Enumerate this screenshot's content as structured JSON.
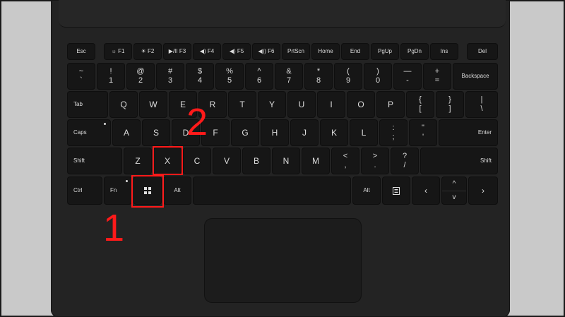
{
  "rows": {
    "function": [
      {
        "name": "key-esc",
        "label": "Esc"
      },
      {
        "name": "key-f1",
        "label": "☼ F1"
      },
      {
        "name": "key-f2",
        "label": "☀ F2"
      },
      {
        "name": "key-f3",
        "label": "▶/II F3"
      },
      {
        "name": "key-f4",
        "label": "◀) F4"
      },
      {
        "name": "key-f5",
        "label": "◀) F5"
      },
      {
        "name": "key-f6",
        "label": "◀)) F6"
      },
      {
        "name": "key-prtscn",
        "label": "PrtScn"
      },
      {
        "name": "key-home",
        "label": "Home"
      },
      {
        "name": "key-end",
        "label": "End"
      },
      {
        "name": "key-pgup",
        "label": "PgUp"
      },
      {
        "name": "key-pgdn",
        "label": "PgDn"
      },
      {
        "name": "key-ins",
        "label": "Ins"
      },
      {
        "name": "key-del",
        "label": "Del"
      }
    ],
    "number": [
      {
        "name": "key-tilde",
        "top": "~",
        "bot": "`"
      },
      {
        "name": "key-1",
        "top": "!",
        "bot": "1"
      },
      {
        "name": "key-2",
        "top": "@",
        "bot": "2"
      },
      {
        "name": "key-3",
        "top": "#",
        "bot": "3"
      },
      {
        "name": "key-4",
        "top": "$",
        "bot": "4"
      },
      {
        "name": "key-5",
        "top": "%",
        "bot": "5"
      },
      {
        "name": "key-6",
        "top": "^",
        "bot": "6"
      },
      {
        "name": "key-7",
        "top": "&",
        "bot": "7"
      },
      {
        "name": "key-8",
        "top": "*",
        "bot": "8"
      },
      {
        "name": "key-9",
        "top": "(",
        "bot": "9"
      },
      {
        "name": "key-0",
        "top": ")",
        "bot": "0"
      },
      {
        "name": "key-minus",
        "top": "—",
        "bot": "-"
      },
      {
        "name": "key-equals",
        "top": "+",
        "bot": "="
      },
      {
        "name": "key-backspace",
        "label": "Backspace"
      }
    ],
    "qwerty": [
      {
        "name": "key-tab",
        "label": "Tab"
      },
      {
        "name": "key-q",
        "label": "Q"
      },
      {
        "name": "key-w",
        "label": "W"
      },
      {
        "name": "key-e",
        "label": "E"
      },
      {
        "name": "key-r",
        "label": "R"
      },
      {
        "name": "key-t",
        "label": "T"
      },
      {
        "name": "key-y",
        "label": "Y"
      },
      {
        "name": "key-u",
        "label": "U"
      },
      {
        "name": "key-i",
        "label": "I"
      },
      {
        "name": "key-o",
        "label": "O"
      },
      {
        "name": "key-p",
        "label": "P"
      },
      {
        "name": "key-lbracket",
        "top": "{",
        "bot": "["
      },
      {
        "name": "key-rbracket",
        "top": "}",
        "bot": "]"
      },
      {
        "name": "key-backslash",
        "top": "|",
        "bot": "\\"
      }
    ],
    "home": [
      {
        "name": "key-caps",
        "label": "Caps"
      },
      {
        "name": "key-a",
        "label": "A"
      },
      {
        "name": "key-s",
        "label": "S"
      },
      {
        "name": "key-d",
        "label": "D"
      },
      {
        "name": "key-f",
        "label": "F"
      },
      {
        "name": "key-g",
        "label": "G"
      },
      {
        "name": "key-h",
        "label": "H"
      },
      {
        "name": "key-j",
        "label": "J"
      },
      {
        "name": "key-k",
        "label": "K"
      },
      {
        "name": "key-l",
        "label": "L"
      },
      {
        "name": "key-semicolon",
        "top": ":",
        "bot": ";"
      },
      {
        "name": "key-quote",
        "top": "\"",
        "bot": "'"
      },
      {
        "name": "key-enter",
        "label": "Enter"
      }
    ],
    "shift": [
      {
        "name": "key-shift-left",
        "label": "Shift"
      },
      {
        "name": "key-z",
        "label": "Z"
      },
      {
        "name": "key-x",
        "label": "X"
      },
      {
        "name": "key-c",
        "label": "C"
      },
      {
        "name": "key-v",
        "label": "V"
      },
      {
        "name": "key-b",
        "label": "B"
      },
      {
        "name": "key-n",
        "label": "N"
      },
      {
        "name": "key-m",
        "label": "M"
      },
      {
        "name": "key-comma",
        "top": "<",
        "bot": ","
      },
      {
        "name": "key-period",
        "top": ">",
        "bot": "."
      },
      {
        "name": "key-slash",
        "top": "?",
        "bot": "/"
      },
      {
        "name": "key-shift-right",
        "label": "Shift"
      }
    ],
    "bottom": [
      {
        "name": "key-ctrl",
        "label": "Ctrl"
      },
      {
        "name": "key-fn",
        "label": "Fn"
      },
      {
        "name": "key-windows",
        "icon": "windows-logo-icon"
      },
      {
        "name": "key-alt-left",
        "label": "Alt"
      },
      {
        "name": "key-space",
        "label": ""
      },
      {
        "name": "key-alt-right",
        "label": "Alt"
      },
      {
        "name": "key-menu",
        "icon": "menu-icon"
      },
      {
        "name": "key-arrow-left",
        "label": "‹"
      },
      {
        "name": "key-arrow-updown",
        "top": "^",
        "bot": "v"
      },
      {
        "name": "key-arrow-right",
        "label": "›"
      }
    ]
  },
  "callouts": {
    "step1": "1",
    "step2": "2"
  },
  "accent_color": "#ff1a1a"
}
